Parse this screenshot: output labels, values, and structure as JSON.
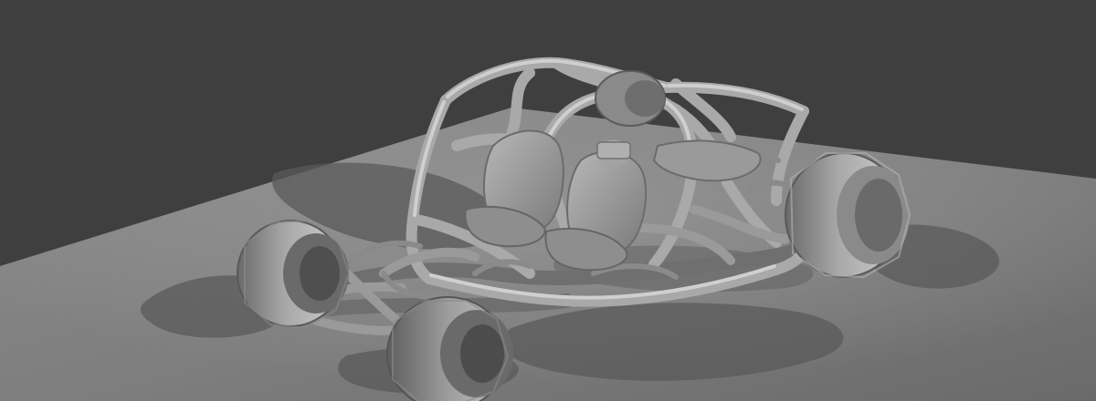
{
  "scene": {
    "subject": "buggy-chassis-render",
    "colors": {
      "background": "#3f3f3f",
      "floor_light": "#8a8a8a",
      "floor_mid": "#7a7a7a",
      "floor_dark": "#5e5e5e",
      "shadow": "#505050",
      "frame_light": "#cfcfcf",
      "frame_mid": "#a9a9a9",
      "frame_dark": "#6f6f6f",
      "tire_light": "#bdbdbd",
      "tire_mid": "#8f8f8f",
      "tire_dark": "#5a5a5a"
    }
  }
}
